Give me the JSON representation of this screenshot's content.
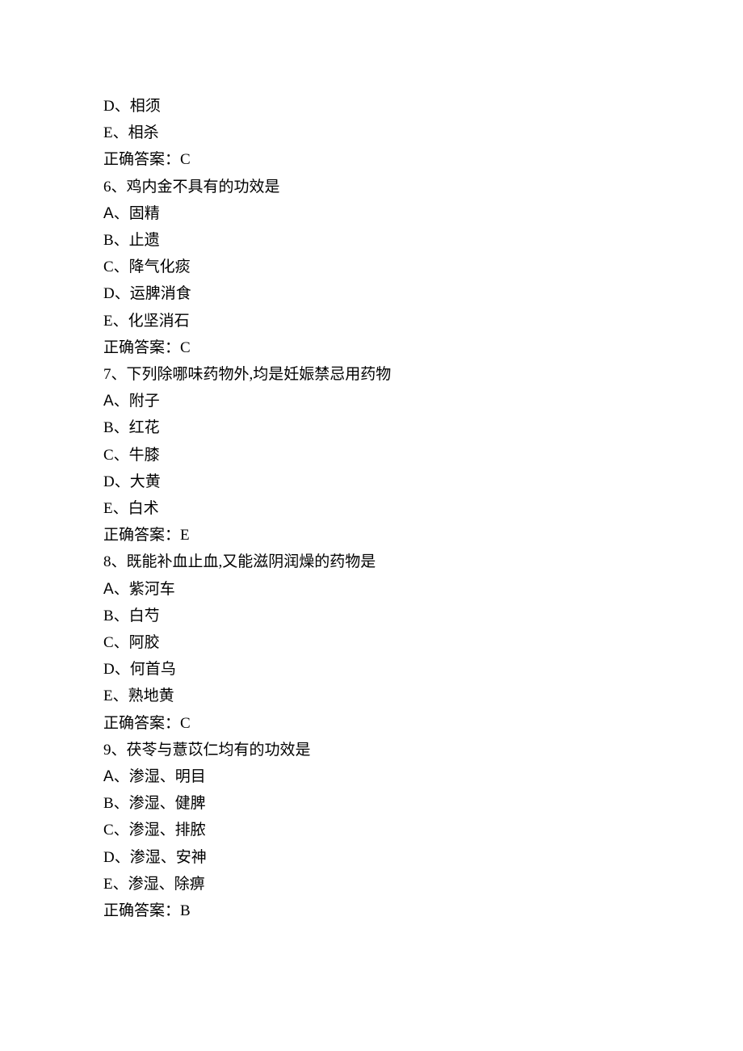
{
  "lines": [
    {
      "text": "D、相须"
    },
    {
      "text": "E、相杀"
    },
    {
      "text": "正确答案：C"
    },
    {
      "text": "6、鸡内金不具有的功效是"
    },
    {
      "label": "A",
      "text": "、固精"
    },
    {
      "text": "B、止遗"
    },
    {
      "text": "C、降气化痰"
    },
    {
      "text": "D、运脾消食"
    },
    {
      "text": "E、化坚消石"
    },
    {
      "text": "正确答案：C"
    },
    {
      "text": "7、下列除哪味药物外,均是妊娠禁忌用药物"
    },
    {
      "label": "A",
      "text": "、附子"
    },
    {
      "text": "B、红花"
    },
    {
      "text": "C、牛膝"
    },
    {
      "text": "D、大黄"
    },
    {
      "text": "E、白术"
    },
    {
      "text": "正确答案：E"
    },
    {
      "text": "8、既能补血止血,又能滋阴润燥的药物是"
    },
    {
      "label": "A",
      "text": "、紫河车"
    },
    {
      "text": "B、白芍"
    },
    {
      "text": "C、阿胶"
    },
    {
      "text": "D、何首乌"
    },
    {
      "text": "E、熟地黄"
    },
    {
      "text": "正确答案：C"
    },
    {
      "text": "9、茯苓与薏苡仁均有的功效是"
    },
    {
      "label": "A",
      "text": "、渗湿、明目"
    },
    {
      "text": "B、渗湿、健脾"
    },
    {
      "text": "C、渗湿、排脓"
    },
    {
      "text": "D、渗湿、安神"
    },
    {
      "text": "E、渗湿、除痹"
    },
    {
      "text": "正确答案：B"
    }
  ]
}
